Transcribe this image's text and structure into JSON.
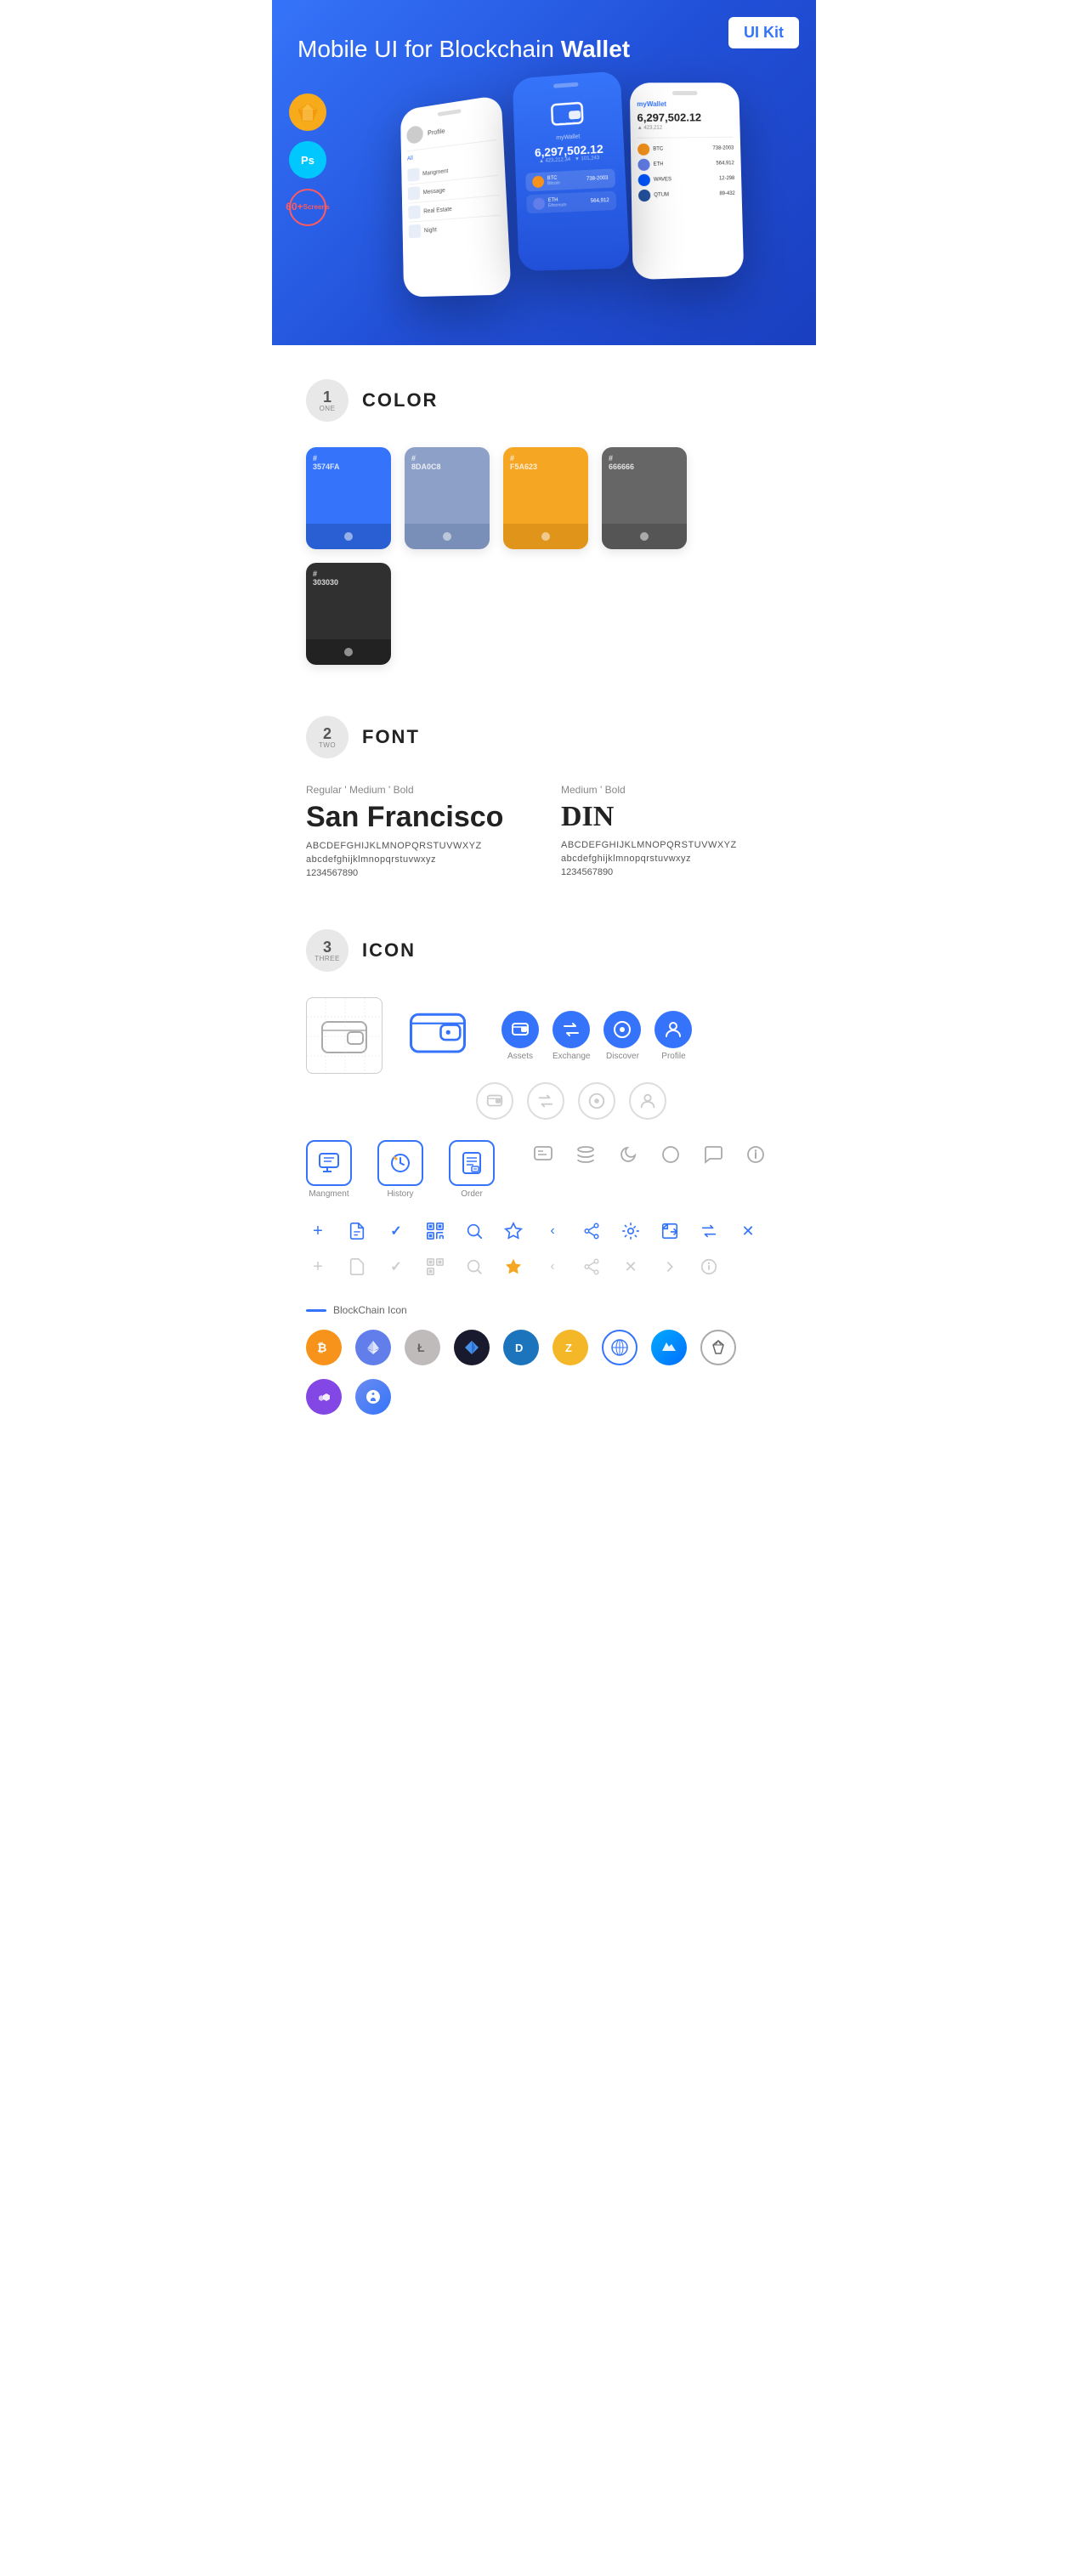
{
  "hero": {
    "title": "Mobile UI for Blockchain ",
    "title_bold": "Wallet",
    "badge": "UI Kit",
    "badge_sketch": "S",
    "badge_ps": "Ps",
    "badge_screens_line1": "60+",
    "badge_screens_line2": "Screens"
  },
  "section1": {
    "number": "1",
    "word": "ONE",
    "title": "COLOR",
    "swatches": [
      {
        "hex": "#3574FA",
        "code": "#\n3574FA"
      },
      {
        "hex": "#8D A0C8",
        "code": "#\n8DA0C8",
        "actual": "#8DA0C8"
      },
      {
        "hex": "#F5A623",
        "code": "#\nF5A623"
      },
      {
        "hex": "#666666",
        "code": "#\n666666"
      },
      {
        "hex": "#303030",
        "code": "#\n303030"
      }
    ]
  },
  "section2": {
    "number": "2",
    "word": "TWO",
    "title": "FONT",
    "font1": {
      "style": "Regular ' Medium ' Bold",
      "name": "San Francisco",
      "upper": "ABCDEFGHIJKLMNOPQRSTUVWXYZ",
      "lower": "abcdefghijklmnopqrstuvwxyz",
      "numbers": "1234567890"
    },
    "font2": {
      "style": "Medium ' Bold",
      "name": "DIN",
      "upper": "ABCDEFGHIJKLMNOPQRSTUVWXYZ",
      "lower": "abcdefghijklmnopqrstuvwxyz",
      "numbers": "1234567890"
    }
  },
  "section3": {
    "number": "3",
    "word": "THREE",
    "title": "ICON",
    "nav_icons": [
      {
        "label": "Assets",
        "color": "#3574FA"
      },
      {
        "label": "Exchange",
        "color": "#3574FA"
      },
      {
        "label": "Discover",
        "color": "#3574FA"
      },
      {
        "label": "Profile",
        "color": "#3574FA"
      }
    ],
    "app_icons": [
      {
        "label": "Mangment"
      },
      {
        "label": "History"
      },
      {
        "label": "Order"
      }
    ],
    "blockchain_label": "BlockChain Icon",
    "crypto": [
      {
        "label": "BTC",
        "class": "ci-btc"
      },
      {
        "label": "ETH",
        "class": "ci-eth"
      },
      {
        "label": "LTC",
        "class": "ci-ltc"
      },
      {
        "label": "⬦",
        "class": "ci-black"
      },
      {
        "label": "D",
        "class": "ci-dash"
      },
      {
        "label": "Z",
        "class": "ci-zcash"
      },
      {
        "label": "◈",
        "class": "ci-grid"
      },
      {
        "label": "W",
        "class": "ci-waves"
      },
      {
        "label": "◇",
        "class": "ci-crystal"
      },
      {
        "label": "▲",
        "class": "ci-matic"
      }
    ]
  }
}
